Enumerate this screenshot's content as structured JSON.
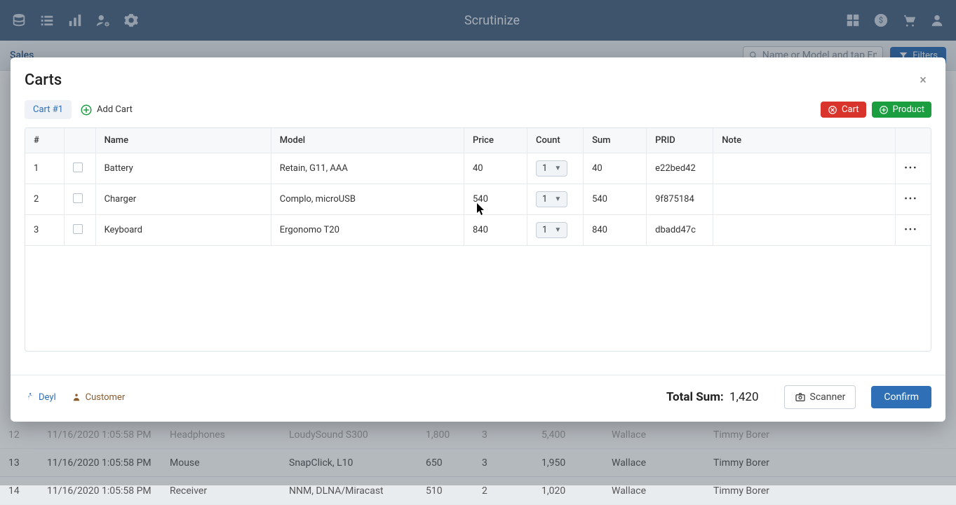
{
  "app": {
    "title": "Scrutinize"
  },
  "subbar": {
    "title": "Sales",
    "search_placeholder": "Name or Model and tap Enter",
    "filters_label": "Filters"
  },
  "modal": {
    "title": "Carts",
    "close_glyph": "×",
    "active_tab": "Cart #1",
    "add_cart_label": "Add Cart",
    "cart_button_label": "Cart",
    "product_button_label": "Product",
    "columns": {
      "num": "#",
      "name": "Name",
      "model": "Model",
      "price": "Price",
      "count": "Count",
      "sum": "Sum",
      "prid": "PRID",
      "note": "Note"
    },
    "rows": [
      {
        "num": "1",
        "name": "Battery",
        "model": "Retain, G11, AAA",
        "price": "40",
        "count": "1",
        "sum": "40",
        "prid": "e22bed42",
        "note": ""
      },
      {
        "num": "2",
        "name": "Charger",
        "model": "Complo, microUSB",
        "price": "540",
        "count": "1",
        "sum": "540",
        "prid": "9f875184",
        "note": ""
      },
      {
        "num": "3",
        "name": "Keyboard",
        "model": "Ergonomo T20",
        "price": "840",
        "count": "1",
        "sum": "840",
        "prid": "dbadd47c",
        "note": ""
      }
    ],
    "footer": {
      "deyl": "Deyl",
      "customer": "Customer",
      "total_label": "Total Sum:",
      "total_value": "1,420",
      "scanner": "Scanner",
      "confirm": "Confirm"
    }
  },
  "bg_rows": [
    {
      "idx": "12",
      "date": "11/16/2020 1:05:58 PM",
      "name": "Headphones",
      "model": "LoudySound S300",
      "price": "1,800",
      "count": "3",
      "sum": "5,400",
      "col7": "Wallace",
      "col8": "Timmy Borer"
    },
    {
      "idx": "13",
      "date": "11/16/2020 1:05:58 PM",
      "name": "Mouse",
      "model": "SnapClick, L10",
      "price": "650",
      "count": "3",
      "sum": "1,950",
      "col7": "Wallace",
      "col8": "Timmy Borer"
    },
    {
      "idx": "14",
      "date": "11/16/2020 1:05:58 PM",
      "name": "Receiver",
      "model": "NNM, DLNA/Miracast",
      "price": "510",
      "count": "2",
      "sum": "1,020",
      "col7": "Wallace",
      "col8": "Timmy Borer"
    }
  ]
}
